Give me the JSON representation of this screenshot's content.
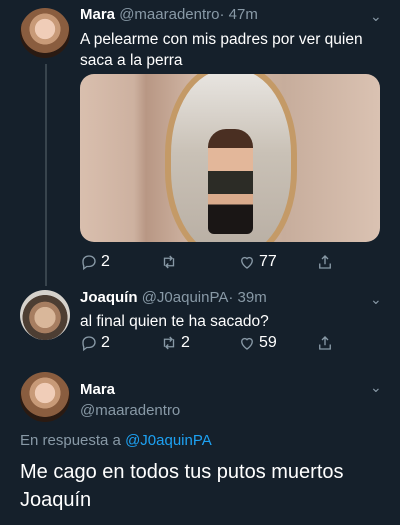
{
  "tweets": [
    {
      "name": "Mara",
      "handle": "@maaradentro",
      "time": "· 47m",
      "text": "A pelearme con mis padres por ver quien saca a la perra",
      "reply_count": "2",
      "retweet_count": "",
      "like_count": "77"
    },
    {
      "name": "Joaquín",
      "handle": "@J0aquinPA",
      "time": "· 39m",
      "text": "al final quien te ha sacado?",
      "reply_count": "2",
      "retweet_count": "2",
      "like_count": "59"
    }
  ],
  "focused": {
    "name": "Mara",
    "handle": "@maaradentro",
    "reply_prefix": "En respuesta a ",
    "reply_mention": "@J0aquinPA",
    "text": "Me cago en todos tus putos muertos Joaquín"
  },
  "colors": {
    "background": "#15202b",
    "secondary_text": "#8899a6",
    "link": "#1da1f2"
  },
  "icons": [
    "reply-icon",
    "retweet-icon",
    "like-icon",
    "share-icon",
    "chevron-down-icon"
  ]
}
